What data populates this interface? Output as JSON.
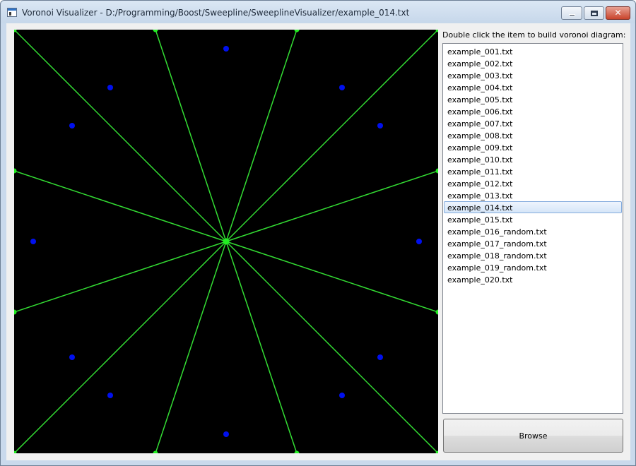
{
  "window": {
    "title": "Voronoi Visualizer - D:/Programming/Boost/Sweepline/SweeplineVisualizer/example_014.txt"
  },
  "controls": {
    "minimize_icon": "minimize-icon",
    "maximize_icon": "maximize-icon",
    "close_icon": "close-icon"
  },
  "instructions": "Double click the item to build voronoi diagram:",
  "files": [
    "example_001.txt",
    "example_002.txt",
    "example_003.txt",
    "example_004.txt",
    "example_005.txt",
    "example_006.txt",
    "example_007.txt",
    "example_008.txt",
    "example_009.txt",
    "example_010.txt",
    "example_011.txt",
    "example_012.txt",
    "example_013.txt",
    "example_014.txt",
    "example_015.txt",
    "example_016_random.txt",
    "example_017_random.txt",
    "example_018_random.txt",
    "example_019_random.txt",
    "example_020.txt"
  ],
  "selected_file": "example_014.txt",
  "browse_label": "Browse",
  "colors": {
    "canvas_background": "#000000",
    "voronoi_edge": "#33dd33",
    "voronoi_vertex": "#22ee22",
    "site_point": "#0010ee",
    "selection": "#d5e6f8"
  }
}
